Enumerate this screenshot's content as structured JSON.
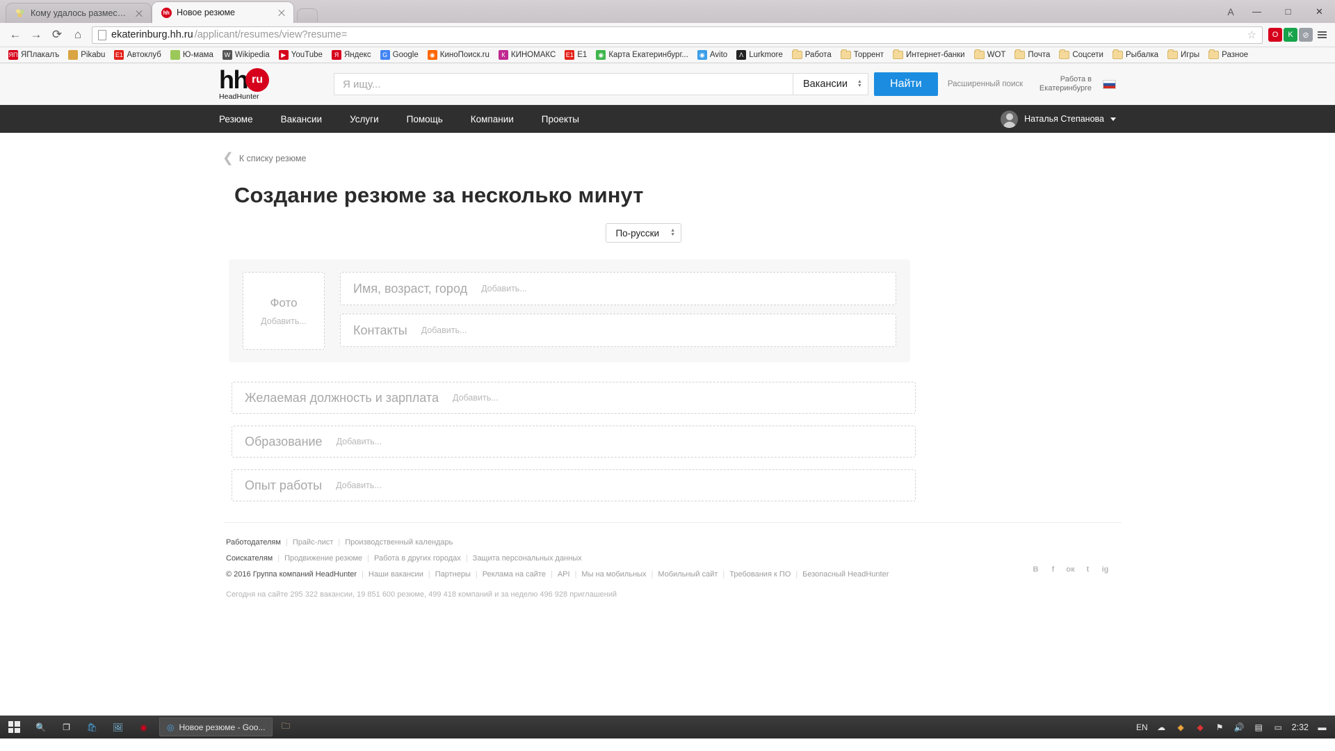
{
  "browser": {
    "tabs": [
      {
        "title": "Кому удалось разместить",
        "icon": "flower-icon",
        "active": false
      },
      {
        "title": "Новое резюме",
        "icon": "hh-favicon",
        "active": true
      }
    ],
    "new_tab_label": "+",
    "window_controls": {
      "minimize": "—",
      "maximize": "□",
      "close": "✕",
      "profile": "A"
    },
    "nav": {
      "back": "←",
      "forward": "→",
      "reload": "⟳",
      "home": "⌂"
    },
    "omnibox": {
      "url_host": "ekaterinburg.hh.ru",
      "url_path": "/applicant/resumes/view?resume=",
      "star": "☆"
    },
    "bookmarks": [
      {
        "label": "ЯПлакалъ",
        "icon": "yaplakal-icon"
      },
      {
        "label": "Pikabu",
        "icon": "pikabu-icon"
      },
      {
        "label": "Автоклуб",
        "icon": "e1-icon"
      },
      {
        "label": "Ю-мама",
        "icon": "umama-icon"
      },
      {
        "label": "Wikipedia",
        "icon": "wikipedia-icon"
      },
      {
        "label": "YouTube",
        "icon": "youtube-icon"
      },
      {
        "label": "Яндекс",
        "icon": "yandex-icon"
      },
      {
        "label": "Google",
        "icon": "google-icon"
      },
      {
        "label": "КиноПоиск.ru",
        "icon": "kinopoisk-icon"
      },
      {
        "label": "КИНОМАКС",
        "icon": "kinomax-icon"
      },
      {
        "label": "E1",
        "icon": "e1-icon"
      },
      {
        "label": "Карта Екатеринбург...",
        "icon": "map-icon"
      },
      {
        "label": "Avito",
        "icon": "avito-icon"
      },
      {
        "label": "Lurkmore",
        "icon": "lurkmore-icon"
      },
      {
        "label": "Работа",
        "icon": "folder-icon"
      },
      {
        "label": "Торрент",
        "icon": "folder-icon"
      },
      {
        "label": "Интернет-банки",
        "icon": "folder-icon"
      },
      {
        "label": "WOT",
        "icon": "folder-icon"
      },
      {
        "label": "Почта",
        "icon": "folder-icon"
      },
      {
        "label": "Соцсети",
        "icon": "folder-icon"
      },
      {
        "label": "Рыбалка",
        "icon": "folder-icon"
      },
      {
        "label": "Игры",
        "icon": "folder-icon"
      },
      {
        "label": "Разное",
        "icon": "folder-icon"
      }
    ]
  },
  "site": {
    "logo": {
      "main": "hh",
      "badge": "ru",
      "sub": "HeadHunter"
    },
    "search": {
      "placeholder": "Я ищу...",
      "value": "",
      "scope": "Вакансии",
      "button": "Найти",
      "advanced": "Расширенный поиск"
    },
    "region": {
      "line1": "Работа в",
      "line2": "Екатеринбурге"
    },
    "nav_items": [
      "Резюме",
      "Вакансии",
      "Услуги",
      "Помощь",
      "Компании",
      "Проекты"
    ],
    "user": {
      "name": "Наталья Степанова"
    }
  },
  "main": {
    "back_link": "К списку резюме",
    "title": "Создание резюме за несколько минут",
    "language_select": "По-русски",
    "photo": {
      "title": "Фото",
      "add": "Добавить..."
    },
    "fields": [
      {
        "title": "Имя, возраст, город",
        "add": "Добавить..."
      },
      {
        "title": "Контакты",
        "add": "Добавить..."
      }
    ],
    "sections": [
      {
        "title": "Желаемая должность и зарплата",
        "add": "Добавить..."
      },
      {
        "title": "Образование",
        "add": "Добавить..."
      },
      {
        "title": "Опыт работы",
        "add": "Добавить..."
      }
    ]
  },
  "footer": {
    "row_employers": {
      "head": "Работодателям",
      "links": [
        "Прайс-лист",
        "Производственный календарь"
      ]
    },
    "row_applicants": {
      "head": "Соискателям",
      "links": [
        "Продвижение резюме",
        "Работа в других городах",
        "Защита персональных данных"
      ]
    },
    "row_copyright": {
      "head": "© 2016 Группа компаний HeadHunter",
      "links": [
        "Наши вакансии",
        "Партнеры",
        "Реклама на сайте",
        "API",
        "Мы на мобильных",
        "Мобильный сайт",
        "Требования к ПО",
        "Безопасный HeadHunter"
      ]
    },
    "stats": "Сегодня на сайте 295 322 вакансии, 19 851 600 резюме, 499 418 компаний и за неделю 496 928 приглашений",
    "socials": [
      "В",
      "f",
      "ок",
      "t",
      "ig"
    ]
  },
  "taskbar": {
    "apps": [
      {
        "label": "Новое резюме - Goo...",
        "icon": "chrome-icon"
      }
    ],
    "pinned": [
      "folder-icon",
      "search-icon",
      "taskview-icon",
      "store-icon",
      "photos-icon",
      "opera-icon"
    ],
    "language": "EN",
    "clock": "2:32",
    "tray": [
      "onedrive-icon",
      "shield-icon",
      "flame-icon",
      "warning-icon",
      "speaker-icon",
      "network-icon",
      "battery-icon",
      "notify-icon"
    ]
  }
}
